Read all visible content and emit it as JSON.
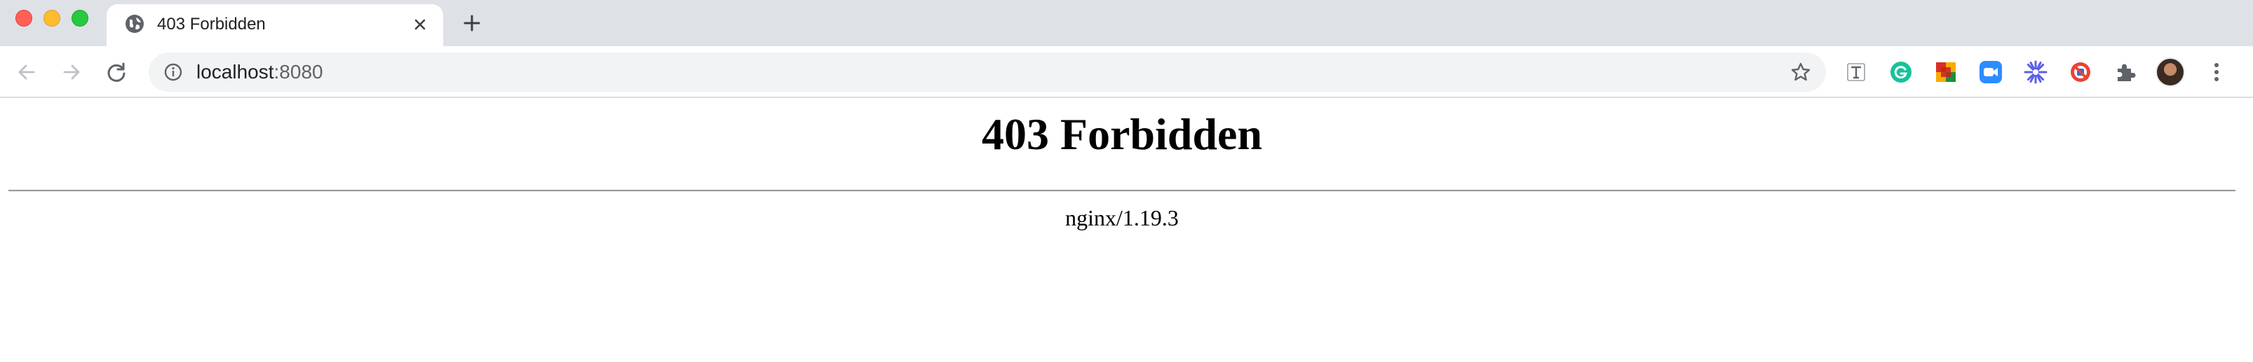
{
  "window_controls": [
    "close",
    "minimize",
    "maximize"
  ],
  "tab": {
    "title": "403 Forbidden",
    "favicon": "globe-icon",
    "close_icon": "close-icon"
  },
  "new_tab_icon": "plus-icon",
  "toolbar": {
    "back_icon": "back-arrow-icon",
    "forward_icon": "forward-arrow-icon",
    "reload_icon": "reload-icon",
    "address": {
      "host": "localhost",
      "port": ":8080",
      "info_icon": "info-icon",
      "bookmark_icon": "star-icon"
    },
    "extensions": [
      "text-t-extension-icon",
      "grammarly-extension-icon",
      "color-blocks-extension-icon",
      "zoom-extension-icon",
      "asterisk-extension-icon",
      "blocked-extension-icon",
      "puzzle-extensions-icon"
    ],
    "profile": "avatar",
    "menu_icon": "kebab-menu-icon"
  },
  "page": {
    "heading": "403 Forbidden",
    "server": "nginx/1.19.3"
  },
  "colors": {
    "tabstrip_bg": "#dee1e6",
    "omnibox_bg": "#f1f3f4",
    "close": "#ff5f57",
    "minimize": "#febc2e",
    "maximize": "#28c840"
  }
}
